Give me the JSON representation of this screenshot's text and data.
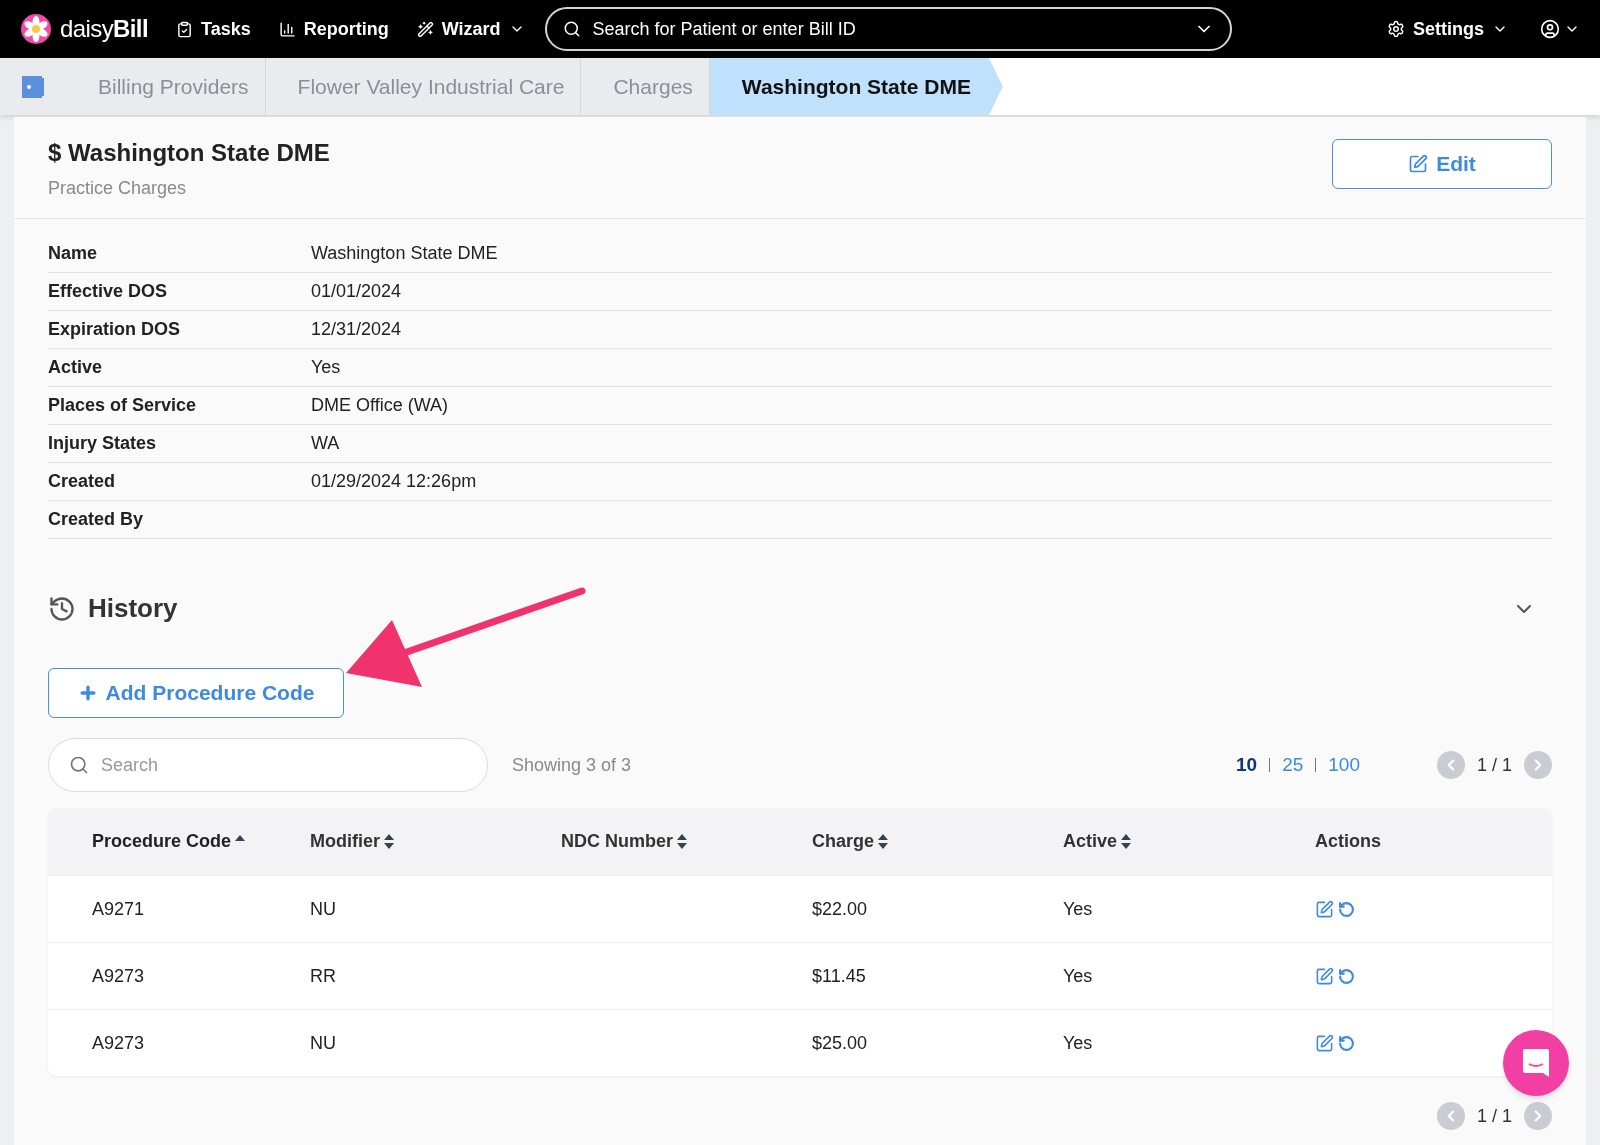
{
  "nav": {
    "logo": "daisy",
    "logo_bold": "Bill",
    "items": [
      {
        "kind": "tasks",
        "label": "Tasks"
      },
      {
        "kind": "reporting",
        "label": "Reporting"
      },
      {
        "kind": "wizard",
        "label": "Wizard"
      }
    ],
    "search": {
      "placeholder": "Search for Patient or enter Bill ID"
    },
    "settings": "Settings"
  },
  "breadcrumbs": [
    {
      "label": "Billing Providers",
      "selected": false
    },
    {
      "label": "Flower Valley Industrial Care",
      "selected": false
    },
    {
      "label": "Charges",
      "selected": false
    },
    {
      "label": "Washington State DME",
      "selected": true
    }
  ],
  "header": {
    "title": "$ Washington State DME",
    "subtitle": "Practice Charges",
    "edit": "Edit"
  },
  "details": [
    {
      "label": "Name",
      "value": "Washington State DME"
    },
    {
      "label": "Effective DOS",
      "value": "01/01/2024"
    },
    {
      "label": "Expiration DOS",
      "value": "12/31/2024"
    },
    {
      "label": "Active",
      "value": "Yes"
    },
    {
      "label": "Places of Service",
      "value": "DME Office (WA)"
    },
    {
      "label": "Injury States",
      "value": "WA"
    },
    {
      "label": "Created",
      "value": "01/29/2024 12:26pm"
    },
    {
      "label": "Created By"
    }
  ],
  "history": {
    "title": "History",
    "expanded": false
  },
  "add_button": "Add Procedure Code",
  "table_search": {
    "placeholder": "Search"
  },
  "showing": "Showing 3 of 3",
  "page_sizes": [
    {
      "label": "10",
      "selected": true
    },
    {
      "label": "25",
      "selected": false
    },
    {
      "label": "100",
      "selected": false
    }
  ],
  "pager_top": "1 / 1",
  "pager_bottom": "1 / 1",
  "columns": [
    {
      "label": "Procedure Code",
      "sortable": true,
      "sorted": true
    },
    {
      "label": "Modifier",
      "sortable": true,
      "sorted": false
    },
    {
      "label": "NDC Number",
      "sortable": true,
      "sorted": false
    },
    {
      "label": "Charge",
      "sortable": true,
      "sorted": false
    },
    {
      "label": "Active",
      "sortable": true,
      "sorted": false
    },
    {
      "label": "Actions",
      "sortable": false,
      "sorted": false
    }
  ],
  "rows": [
    [
      "A9271",
      "NU",
      "",
      "$22.00",
      "Yes"
    ],
    [
      "A9273",
      "RR",
      "",
      "$11.45",
      "Yes"
    ],
    [
      "A9273",
      "NU",
      "",
      "$25.00",
      "Yes"
    ]
  ]
}
